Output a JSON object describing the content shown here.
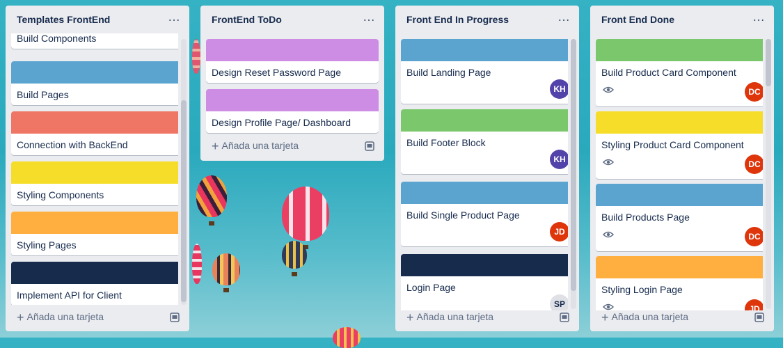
{
  "lists": [
    {
      "title": "Templates FrontEnd",
      "add_label": "Añada una tarjeta",
      "cards": [
        {
          "title": "Build Components",
          "cover": "",
          "avatar": ""
        },
        {
          "title": "Build Pages",
          "cover": "#5ba4cf",
          "avatar": ""
        },
        {
          "title": "Connection with BackEnd",
          "cover": "#ef7564",
          "avatar": ""
        },
        {
          "title": "Styling Components",
          "cover": "#f5dd29",
          "avatar": ""
        },
        {
          "title": "Styling Pages",
          "cover": "#ffaf3f",
          "avatar": ""
        },
        {
          "title": "Implement API for Client",
          "cover": "#172b4d",
          "avatar": ""
        }
      ]
    },
    {
      "title": "FrontEnd ToDo",
      "add_label": "Añada una tarjeta",
      "cards": [
        {
          "title": "Design Reset Password Page",
          "cover": "#cd8de5",
          "avatar": ""
        },
        {
          "title": "Design Profile Page/ Dashboard",
          "cover": "#cd8de5",
          "avatar": ""
        }
      ]
    },
    {
      "title": "Front End In Progress",
      "add_label": "Añada una tarjeta",
      "cards": [
        {
          "title": "Build Landing Page",
          "cover": "#5ba4cf",
          "avatar": "KH"
        },
        {
          "title": "Build Footer Block",
          "cover": "#7bc86c",
          "avatar": "KH"
        },
        {
          "title": "Build Single Product Page",
          "cover": "#5ba4cf",
          "avatar": "JD"
        },
        {
          "title": "Login Page",
          "cover": "#172b4d",
          "avatar": "SP"
        }
      ]
    },
    {
      "title": "Front End Done",
      "add_label": "Añada una tarjeta",
      "cards": [
        {
          "title": "Build Product Card Component",
          "cover": "#7bc86c",
          "avatar": "DC"
        },
        {
          "title": "Styling Product Card Component",
          "cover": "#f5dd29",
          "avatar": "DC"
        },
        {
          "title": "Build Products Page",
          "cover": "#5ba4cf",
          "avatar": "DC"
        },
        {
          "title": "Styling Login Page",
          "cover": "#ffaf3f",
          "avatar": "JD"
        }
      ]
    }
  ],
  "avatar_colors": {
    "KH": "#5243aa",
    "JD": "#de350b",
    "DC": "#de350b",
    "SP": "#dfe1e6"
  },
  "menu_glyph": "…"
}
